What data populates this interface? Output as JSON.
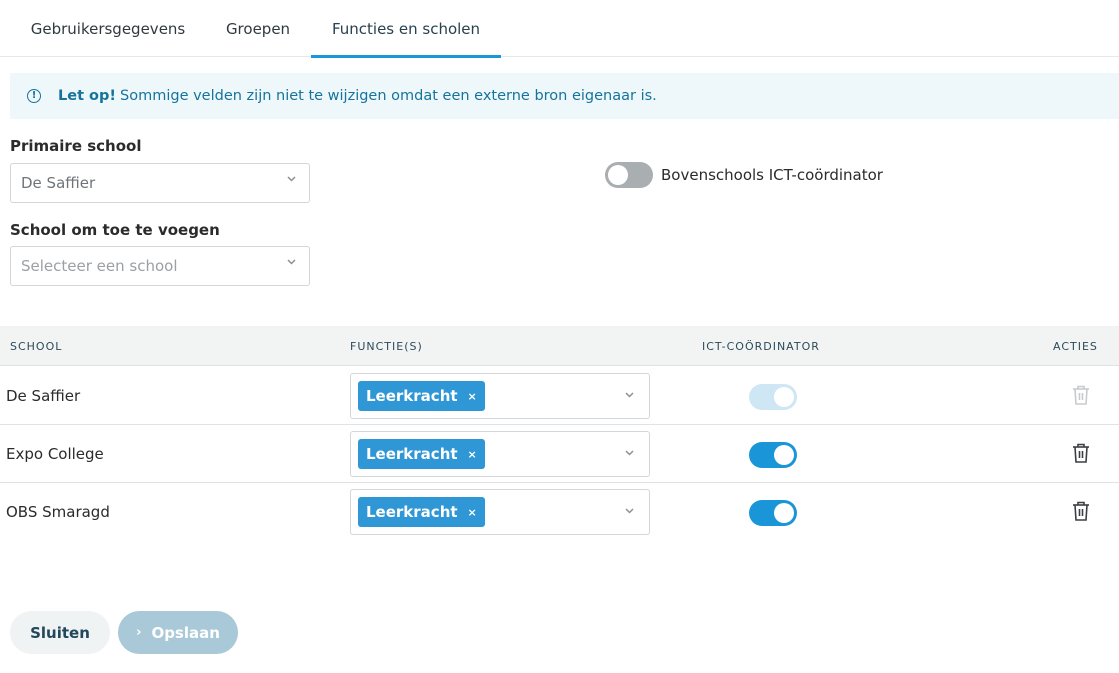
{
  "tabs": [
    {
      "label": "Gebruikersgegevens"
    },
    {
      "label": "Groepen"
    },
    {
      "label": "Functies en scholen",
      "active": true
    }
  ],
  "notice": {
    "strong": "Let op!",
    "text": "Sommige velden zijn niet te wijzigen omdat een externe bron eigenaar is.",
    "icon": "info-icon"
  },
  "form": {
    "primary_school_label": "Primaire school",
    "primary_school_value": "De Saffier",
    "add_school_label": "School om toe te voegen",
    "add_school_placeholder": "Selecteer een school",
    "ict_toggle_label": "Bovenschools ICT-coördinator",
    "ict_toggle_on": false
  },
  "table": {
    "headers": {
      "school": "SCHOOL",
      "functions": "FUNCTIE(S)",
      "ict": "ICT-COÖRDINATOR",
      "actions": "ACTIES"
    },
    "rows": [
      {
        "school": "De Saffier",
        "tag": "Leerkracht",
        "ict_on": true,
        "disabled": true
      },
      {
        "school": "Expo College",
        "tag": "Leerkracht",
        "ict_on": true,
        "disabled": false
      },
      {
        "school": "OBS Smaragd",
        "tag": "Leerkracht",
        "ict_on": true,
        "disabled": false
      }
    ],
    "tag_remove": "×"
  },
  "buttons": {
    "close": "Sluiten",
    "save": "Opslaan",
    "save_icon": "›"
  },
  "colors": {
    "accent": "#1a95d8",
    "notice_bg": "#eef8fb",
    "notice_text": "#16739c",
    "save_disabled": "#a9c9d8"
  }
}
